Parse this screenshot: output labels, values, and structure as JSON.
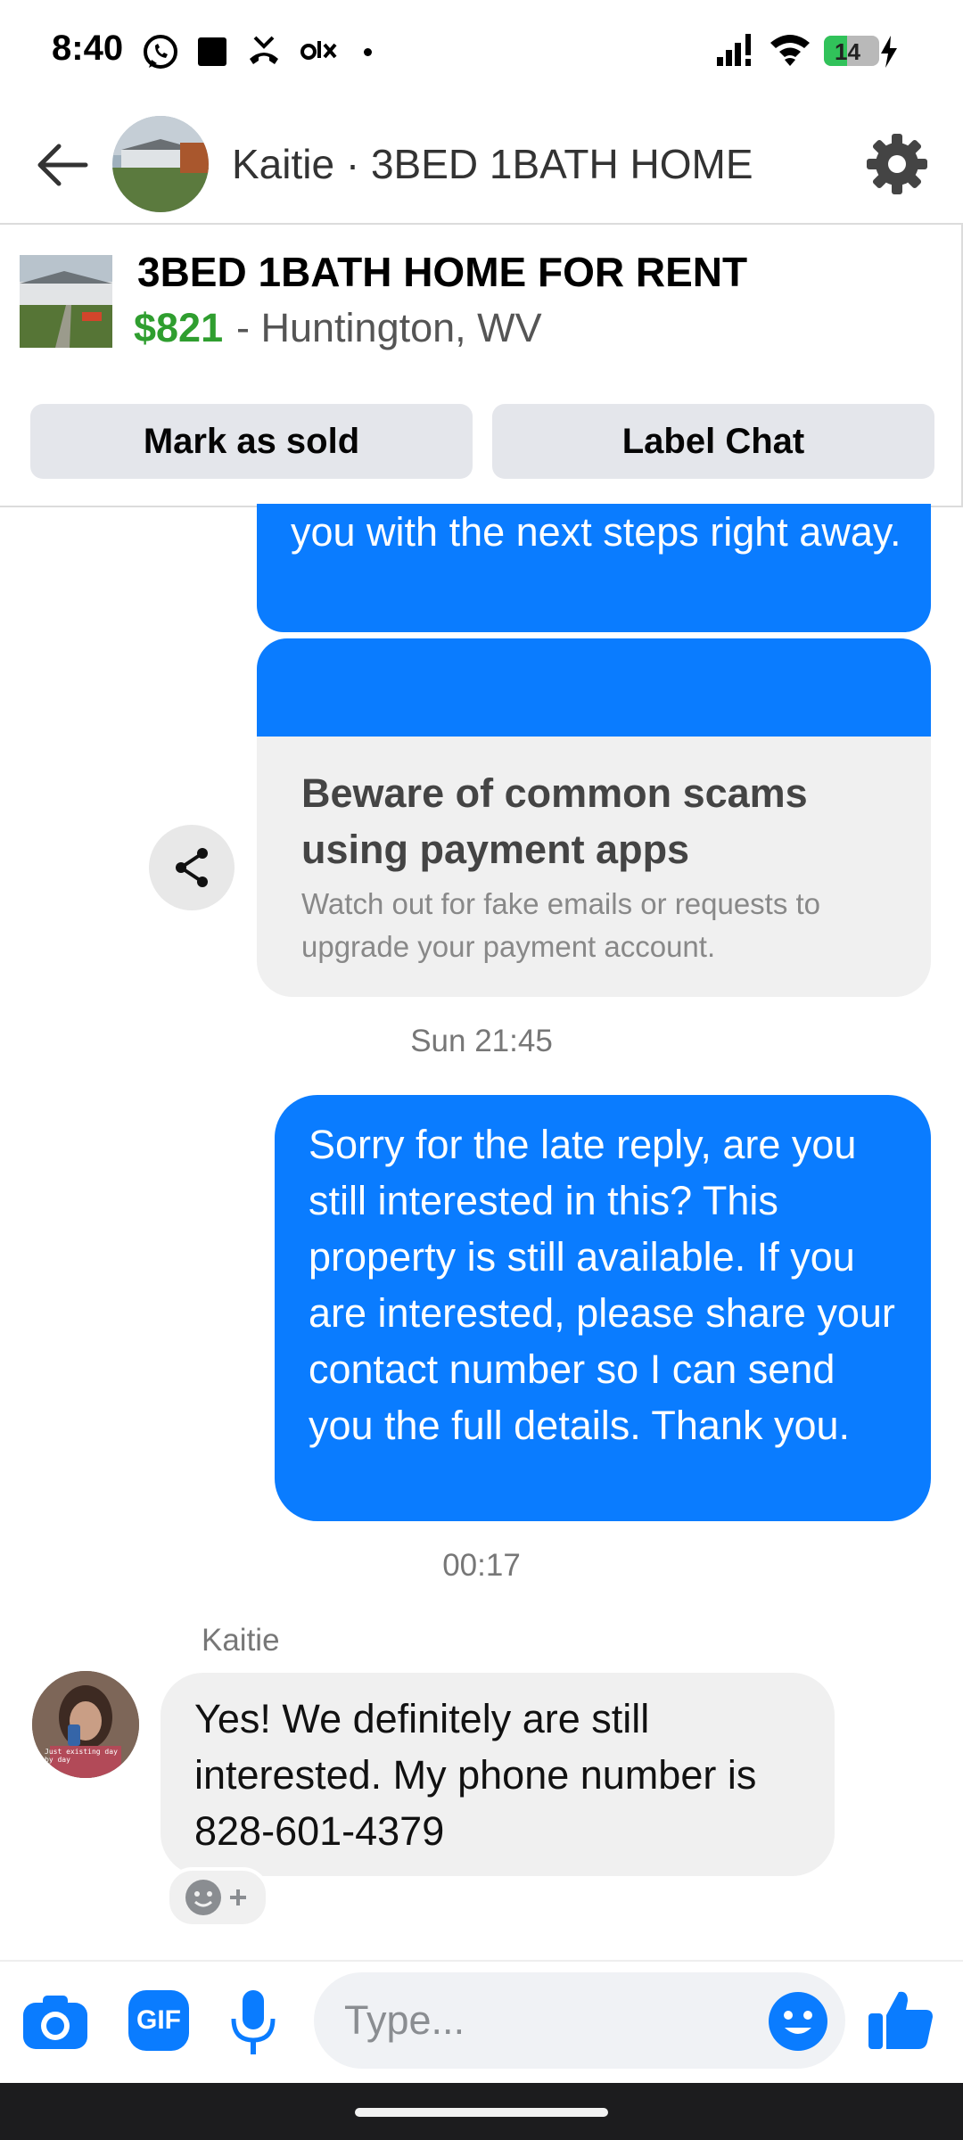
{
  "status_bar": {
    "time": "8:40",
    "battery_level": "14",
    "battery_fraction": 0.14,
    "icons": [
      "whatsapp-icon",
      "square-icon",
      "missed-call-icon",
      "olx-icon",
      "dot-icon",
      "signal-icon",
      "wifi-icon",
      "battery-icon",
      "charging-icon"
    ]
  },
  "header": {
    "title": "Kaitie · 3BED 1BATH HOME",
    "icons": [
      "back-arrow-icon",
      "settings-gear-icon"
    ]
  },
  "listing": {
    "title": "3BED 1BATH HOME FOR RENT",
    "price": "$821",
    "location": "- Huntington, WV",
    "mark_sold_label": "Mark as sold",
    "label_chat_label": "Label Chat"
  },
  "chat": {
    "partial_message": "you with the next steps right away.",
    "scam_card": {
      "title": "Beware of common scams using payment apps",
      "body": "Watch out for fake emails or requests to upgrade your payment account."
    },
    "timestamp_1": "Sun 21:45",
    "sent_message": "Sorry for the late reply, are you still interested in this? This property is still available. If you are interested, please share your contact number so I can send you the full details. Thank you.",
    "timestamp_2": "00:17",
    "sender_name": "Kaitie",
    "received_message": "Yes!  We definitely are still interested.  My phone number is 828-601-4379",
    "avatar_caption": "Just existing day by day"
  },
  "composer": {
    "placeholder": "Type...",
    "gif_label": "GIF"
  },
  "colors": {
    "messenger_blue": "#0a7cff",
    "price_green": "#2f9e2f",
    "bubble_gray": "#f0f0f0"
  }
}
